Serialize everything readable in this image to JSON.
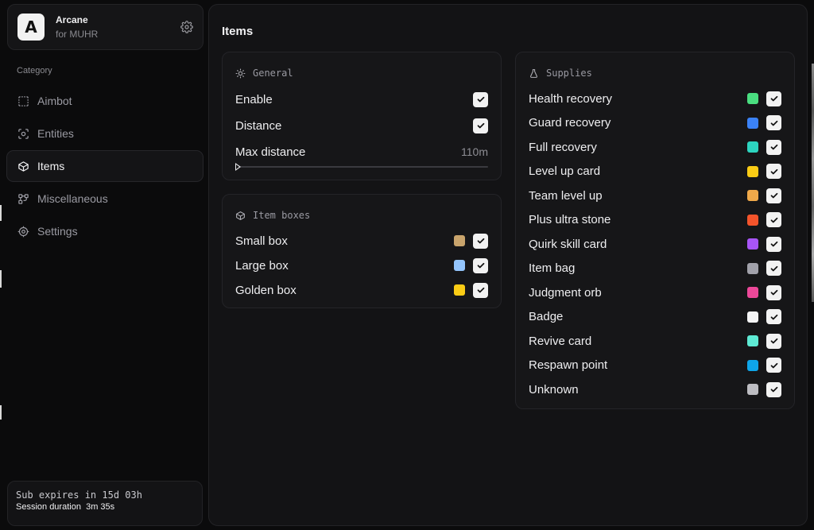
{
  "brand": {
    "logo_letter": "A",
    "name": "Arcane",
    "subtitle": "for MUHR"
  },
  "sidebar": {
    "category_label": "Category",
    "items": [
      {
        "label": "Aimbot",
        "icon": "crosshair-dashed-icon",
        "active": false
      },
      {
        "label": "Entities",
        "icon": "scan-face-icon",
        "active": false
      },
      {
        "label": "Items",
        "icon": "box-icon",
        "active": true
      },
      {
        "label": "Miscellaneous",
        "icon": "grid-dots-icon",
        "active": false
      },
      {
        "label": "Settings",
        "icon": "gear-icon",
        "active": false
      }
    ]
  },
  "footer": {
    "expire_text": "Sub expires in 15d 03h",
    "session_label": "Session duration",
    "session_value": "3m 35s"
  },
  "main": {
    "title": "Items",
    "general": {
      "title": "General",
      "enable_label": "Enable",
      "enable_checked": true,
      "distance_label": "Distance",
      "distance_checked": true,
      "max_distance_label": "Max distance",
      "max_distance_value": "110m",
      "max_distance_fraction": 0.0
    },
    "item_boxes": {
      "title": "Item boxes",
      "rows": [
        {
          "label": "Small box",
          "color": "#c9a46c",
          "checked": true
        },
        {
          "label": "Large box",
          "color": "#93c5fd",
          "checked": true
        },
        {
          "label": "Golden box",
          "color": "#facc15",
          "checked": true
        }
      ]
    },
    "supplies": {
      "title": "Supplies",
      "rows": [
        {
          "label": "Health recovery",
          "color": "#4ade80",
          "checked": true
        },
        {
          "label": "Guard recovery",
          "color": "#3b82f6",
          "checked": true
        },
        {
          "label": "Full recovery",
          "color": "#2dd4bf",
          "checked": true
        },
        {
          "label": "Level up card",
          "color": "#facc15",
          "checked": true
        },
        {
          "label": "Team level up",
          "color": "#f0a94a",
          "checked": true
        },
        {
          "label": "Plus ultra stone",
          "color": "#f4542b",
          "checked": true
        },
        {
          "label": "Quirk skill card",
          "color": "#a855f7",
          "checked": true
        },
        {
          "label": "Item bag",
          "color": "#a1a1aa",
          "checked": true
        },
        {
          "label": "Judgment orb",
          "color": "#ec4899",
          "checked": true
        },
        {
          "label": "Badge",
          "color": "#f4f4f5",
          "checked": true
        },
        {
          "label": "Revive card",
          "color": "#5eead4",
          "checked": true
        },
        {
          "label": "Respawn point",
          "color": "#0ea5e9",
          "checked": true
        },
        {
          "label": "Unknown",
          "color": "#bdbdc2",
          "checked": true
        }
      ]
    }
  }
}
